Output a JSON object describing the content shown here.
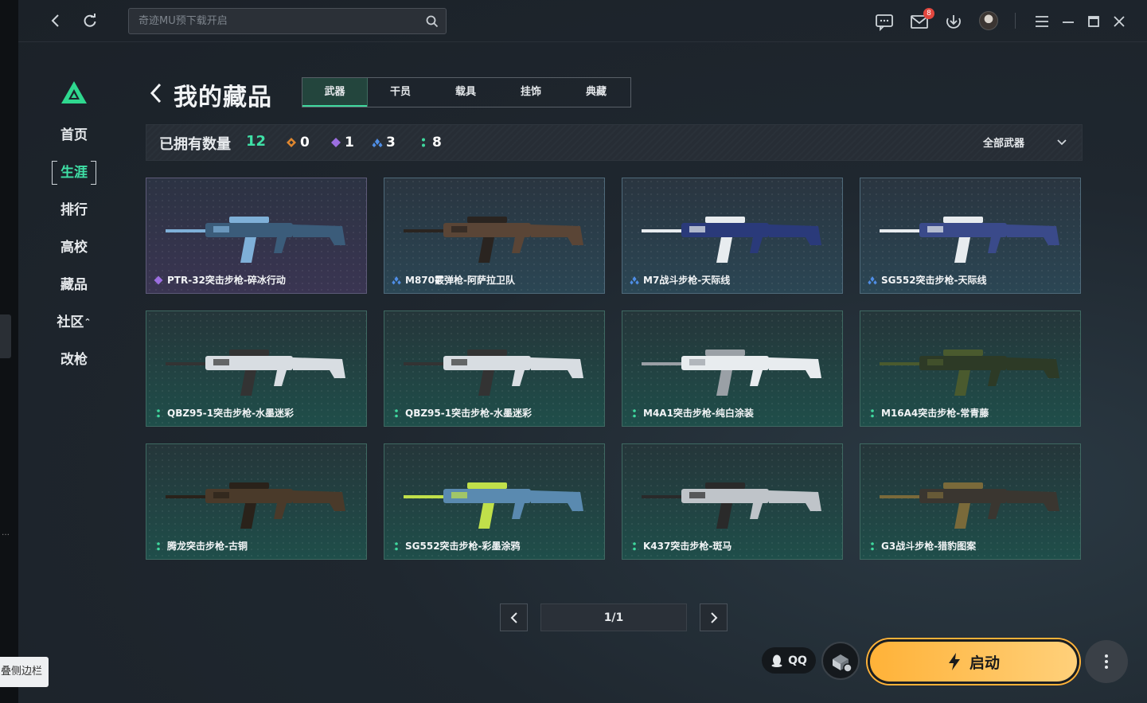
{
  "sidebar_collapse_label": "叠侧边栏",
  "search": {
    "placeholder": "奇迹MU预下载开启"
  },
  "topbar": {
    "mail_badge": "8"
  },
  "sidebar": {
    "items": [
      {
        "label": "首页"
      },
      {
        "label": "生涯"
      },
      {
        "label": "排行"
      },
      {
        "label": "高校"
      },
      {
        "label": "藏品"
      },
      {
        "label": "社区"
      },
      {
        "label": "改枪"
      }
    ],
    "active": "生涯"
  },
  "page": {
    "title": "我的藏品"
  },
  "tabs": [
    {
      "label": "武器"
    },
    {
      "label": "干员"
    },
    {
      "label": "载具"
    },
    {
      "label": "挂饰"
    },
    {
      "label": "典藏"
    }
  ],
  "summary": {
    "label": "已拥有数量",
    "total": "12",
    "rarities": [
      {
        "color": "#e0872f",
        "count": "0"
      },
      {
        "color": "#9b6ee0",
        "count": "1"
      },
      {
        "color": "#4f8ee6",
        "count": "3"
      },
      {
        "color": "#3fd89e",
        "count": "8"
      }
    ],
    "filter_label": "全部武器"
  },
  "items": [
    {
      "name": "PTR-32突击步枪-碎冰行动",
      "rarity": "purple"
    },
    {
      "name": "M870霰弹枪-阿萨拉卫队",
      "rarity": "blue"
    },
    {
      "name": "M7战斗步枪-天际线",
      "rarity": "blue"
    },
    {
      "name": "SG552突击步枪-天际线",
      "rarity": "blue"
    },
    {
      "name": "QBZ95-1突击步枪-水墨迷彩",
      "rarity": "green"
    },
    {
      "name": "QBZ95-1突击步枪-水墨迷彩",
      "rarity": "green"
    },
    {
      "name": "M4A1突击步枪-纯白涂装",
      "rarity": "green"
    },
    {
      "name": "M16A4突击步枪-常青藤",
      "rarity": "green"
    },
    {
      "name": "腾龙突击步枪-古铜",
      "rarity": "green"
    },
    {
      "name": "SG552突击步枪-彩墨涂鸦",
      "rarity": "green"
    },
    {
      "name": "K437突击步枪-斑马",
      "rarity": "green"
    },
    {
      "name": "G3战斗步枪-猎豹图案",
      "rarity": "green"
    }
  ],
  "pager": {
    "text": "1/1"
  },
  "bottom": {
    "qq_label": "QQ",
    "launch_label": "启动"
  },
  "colors": {
    "accent": "#3fe0a6",
    "launch": "#ffb238"
  }
}
